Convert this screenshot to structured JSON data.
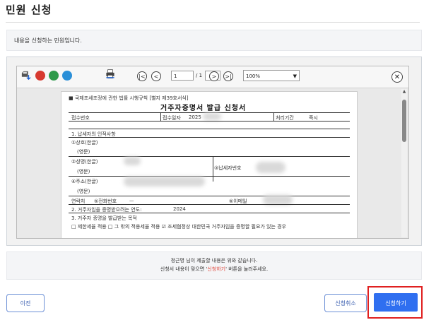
{
  "page": {
    "title": "민원 신청",
    "info_text": "내용을 신청하는 민원입니다."
  },
  "viewer": {
    "toolbar": {
      "page_input": "1",
      "page_total": "/ 1",
      "zoom": "100%",
      "close_symbol": "✕",
      "first_symbol": "|<",
      "prev_symbol": "<",
      "next_symbol": ">",
      "last_symbol": ">|"
    },
    "document": {
      "header_note": "■ 국제조세조정에 관한 법률 시행규칙 [별지 제39호서식]",
      "title": "거주자증명서 발급 신청서",
      "receipt_no_label": "접수번호",
      "receipt_date_label": "접수일자",
      "receipt_date_value": "2025",
      "processing_period_label": "처리기간",
      "processing_period_value": "즉시",
      "section1": "1. 납세자의 인적사항",
      "trade_name": "①상호(한글)",
      "english1": "(영문)",
      "name": "②성명(한글)",
      "english2": "(영문)",
      "taxpayer_no": "③납세자번호",
      "address": "④주소(한글)",
      "english3": "(영문)",
      "contact": "연락처",
      "phone": "⑤전화번호",
      "phone_value": "ㅡ",
      "email": "⑥이메일",
      "section2": "2. 거주자임을 증명받으려는 연도:",
      "section2_year": "2024",
      "section3": "3. 거주자 증명을 발급받는 목적",
      "purpose_line": "□ 제한세율 적용   □ 그 밖의 적용세율 적용   ☑ 조세협정상 대한민국 거주자임을 증명할 필요가 있는 경우"
    }
  },
  "notice": {
    "line1": "정근명 님이 제출할 내용은 위와 같습니다.",
    "line2_prefix": "신청서 내용이 맞으면 '",
    "line2_highlight": "신청하기",
    "line2_suffix": "' 버튼을 눌러주세요."
  },
  "buttons": {
    "prev": "이전",
    "cancel": "신청취소",
    "submit": "신청하기"
  },
  "colors": {
    "primary": "#2f6ff0",
    "outline_highlight": "#e02020",
    "notice_highlight": "#e0453a"
  }
}
